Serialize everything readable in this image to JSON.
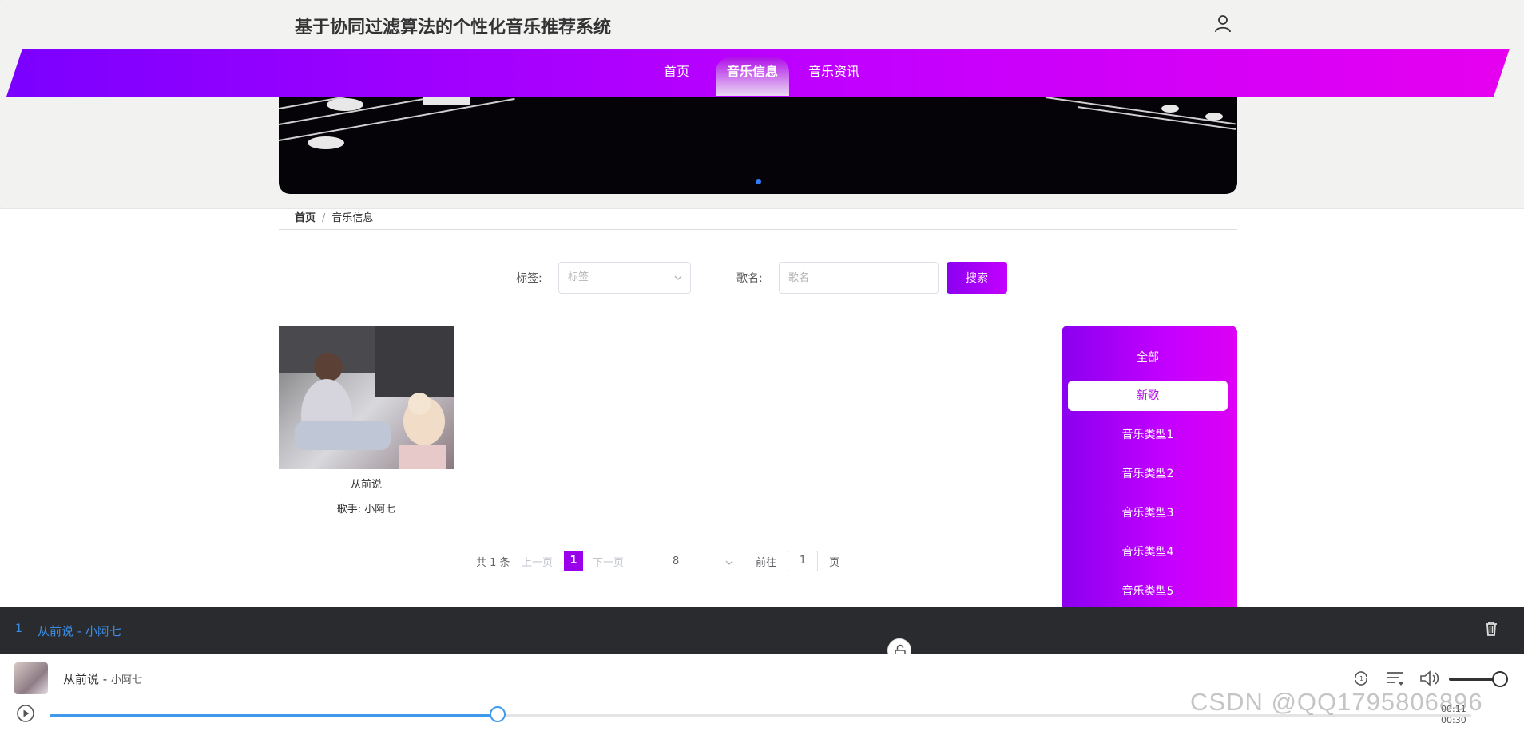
{
  "header": {
    "site_title": "基于协同过滤算法的个性化音乐推荐系统",
    "user_icon": "user-icon"
  },
  "nav": {
    "items": [
      {
        "label": "首页",
        "active": false
      },
      {
        "label": "音乐信息",
        "active": true
      },
      {
        "label": "音乐资讯",
        "active": false
      }
    ]
  },
  "breadcrumb": {
    "home": "首页",
    "separator": "/",
    "current": "音乐信息"
  },
  "search": {
    "tag_label": "标签:",
    "tag_placeholder": "标签",
    "name_label": "歌名:",
    "name_placeholder": "歌名",
    "button_label": "搜索"
  },
  "music_list": [
    {
      "title": "从前说",
      "artist": "歌手: 小阿七"
    }
  ],
  "pagination": {
    "total_text": "共 1 条",
    "prev": "上一页",
    "current_page": "1",
    "next": "下一页",
    "page_size": "8",
    "goto_label": "前往",
    "goto_value": "1",
    "page_suffix": "页"
  },
  "categories": {
    "items": [
      {
        "label": "全部",
        "active": false
      },
      {
        "label": "新歌",
        "active": true
      },
      {
        "label": "音乐类型1",
        "active": false
      },
      {
        "label": "音乐类型2",
        "active": false
      },
      {
        "label": "音乐类型3",
        "active": false
      },
      {
        "label": "音乐类型4",
        "active": false
      },
      {
        "label": "音乐类型5",
        "active": false
      }
    ]
  },
  "playlist": {
    "index": "1",
    "title": "从前说 - 小阿七"
  },
  "player": {
    "song": "从前说 - ",
    "artist": "小阿七",
    "time_current": "00:11",
    "time_total": "00:30",
    "progress_fraction": 0.315,
    "volume_fraction": 0.85
  },
  "watermark": "CSDN @QQ1795806896",
  "colors": {
    "accent": "#9a00ea",
    "nav_start": "#7b00ff",
    "nav_end": "#e600f0",
    "player_blue": "#3f9aee",
    "playlist_bg": "#2a2b2e"
  }
}
